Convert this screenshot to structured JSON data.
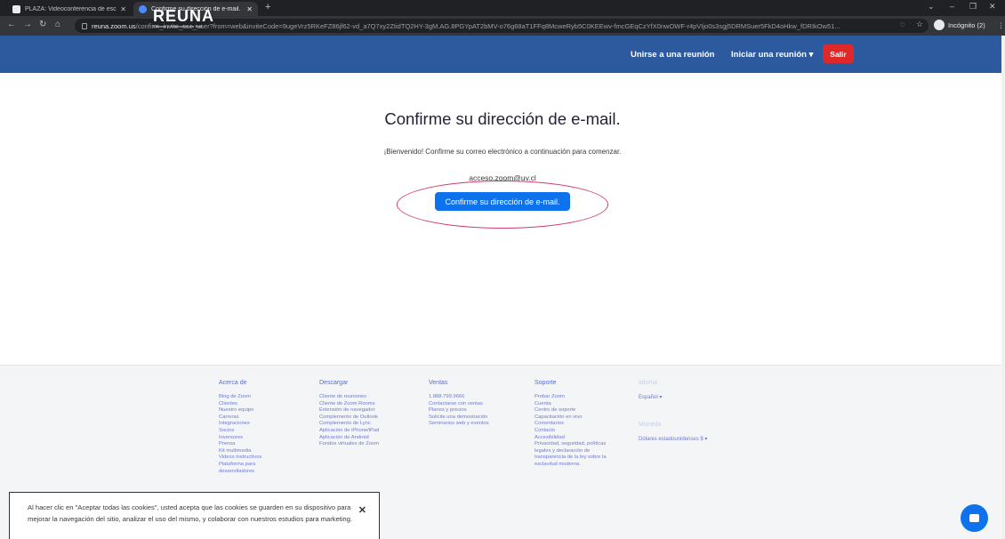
{
  "browser": {
    "tabs": [
      {
        "title": "PLAZA: Videoconferencia de esc"
      },
      {
        "title": "Confirme su dirección de e-mail."
      }
    ],
    "url_host": "reuna.zoom.us",
    "url_path": "/confirm_invite_sso_user?from=web&inviteCode=9ugeVrz5RKeFZ86jf62-vd_a7Q7xy2ZtidTQ2HY-3gM.AG.8PGYpAT2bMV-o76g68aT1FFq8McweRyb5C0KEEwv-fmcGEqCzYfX0nwOWF-r4pVIjo0s3sgj5DRMSuer5FkD4oHkw_fDRIkOw51...",
    "incognito_label": "Incógnito (2)"
  },
  "header": {
    "logo_text": "REUNA",
    "logo_sub": "Ciencia y Educación en Red",
    "join_label": "Unirse a una reunión",
    "start_label": "Iniciar una reunión",
    "exit_label": "Salir"
  },
  "main": {
    "title": "Confirme su dirección de e-mail.",
    "welcome": "¡Bienvenido! Confirme su correo electrónico a continuación para comenzar.",
    "email": "acceso.zoom@uv.cl",
    "confirm_label": "Confirme su dirección de e-mail."
  },
  "footer": {
    "about": {
      "heading": "Acerca de",
      "items": [
        "Blog de Zoom",
        "Clientes",
        "Nuestro equipo",
        "Carreras",
        "Integraciones",
        "Socios",
        "Inversores",
        "Prensa",
        "Kit multimedia",
        "Videos instructivos",
        "Plataforma para",
        "desarrolladores"
      ]
    },
    "download": {
      "heading": "Descargar",
      "items": [
        "Cliente de reuniones",
        "Cliente de Zoom Rooms",
        "Extensión de navegador",
        "Complemento de Outlook",
        "Complemento de Lync",
        "Aplicación de iPhone/iPad",
        "Aplicación de Android",
        "Fondos virtuales de Zoom"
      ]
    },
    "sales": {
      "heading": "Ventas",
      "items": [
        "1.888.799.9666",
        "Contactarse con ventas",
        "Planes y precios",
        "Solicite una demostración",
        "Seminarios web y eventos"
      ]
    },
    "support": {
      "heading": "Soporte",
      "items": [
        "Probar Zoom",
        "Cuenta",
        "Centro de soporte",
        "Capacitación en vivo",
        "Comentarios",
        "Contacto",
        "Accesibilidad",
        "Privacidad, seguridad, políticas",
        "legales y declaración de",
        "transparencia de la ley sobre la",
        "esclavitud moderna"
      ]
    },
    "language": {
      "heading": "Idioma",
      "value": "Español"
    },
    "currency": {
      "heading": "Moneda",
      "value": "Dólares estadounidenses $"
    }
  },
  "cookie": {
    "text": "Al hacer clic en \"Aceptar todas las cookies\", usted acepta que las cookies se guarden en su dispositivo para mejorar la navegación del sitio, analizar el uso del mismo, y colaborar con nuestros estudios para marketing."
  },
  "colors": {
    "header_bg": "#2d5a9e",
    "primary_button": "#0e72ed",
    "exit_button": "#e02828",
    "annotation": "#d03a6e"
  }
}
